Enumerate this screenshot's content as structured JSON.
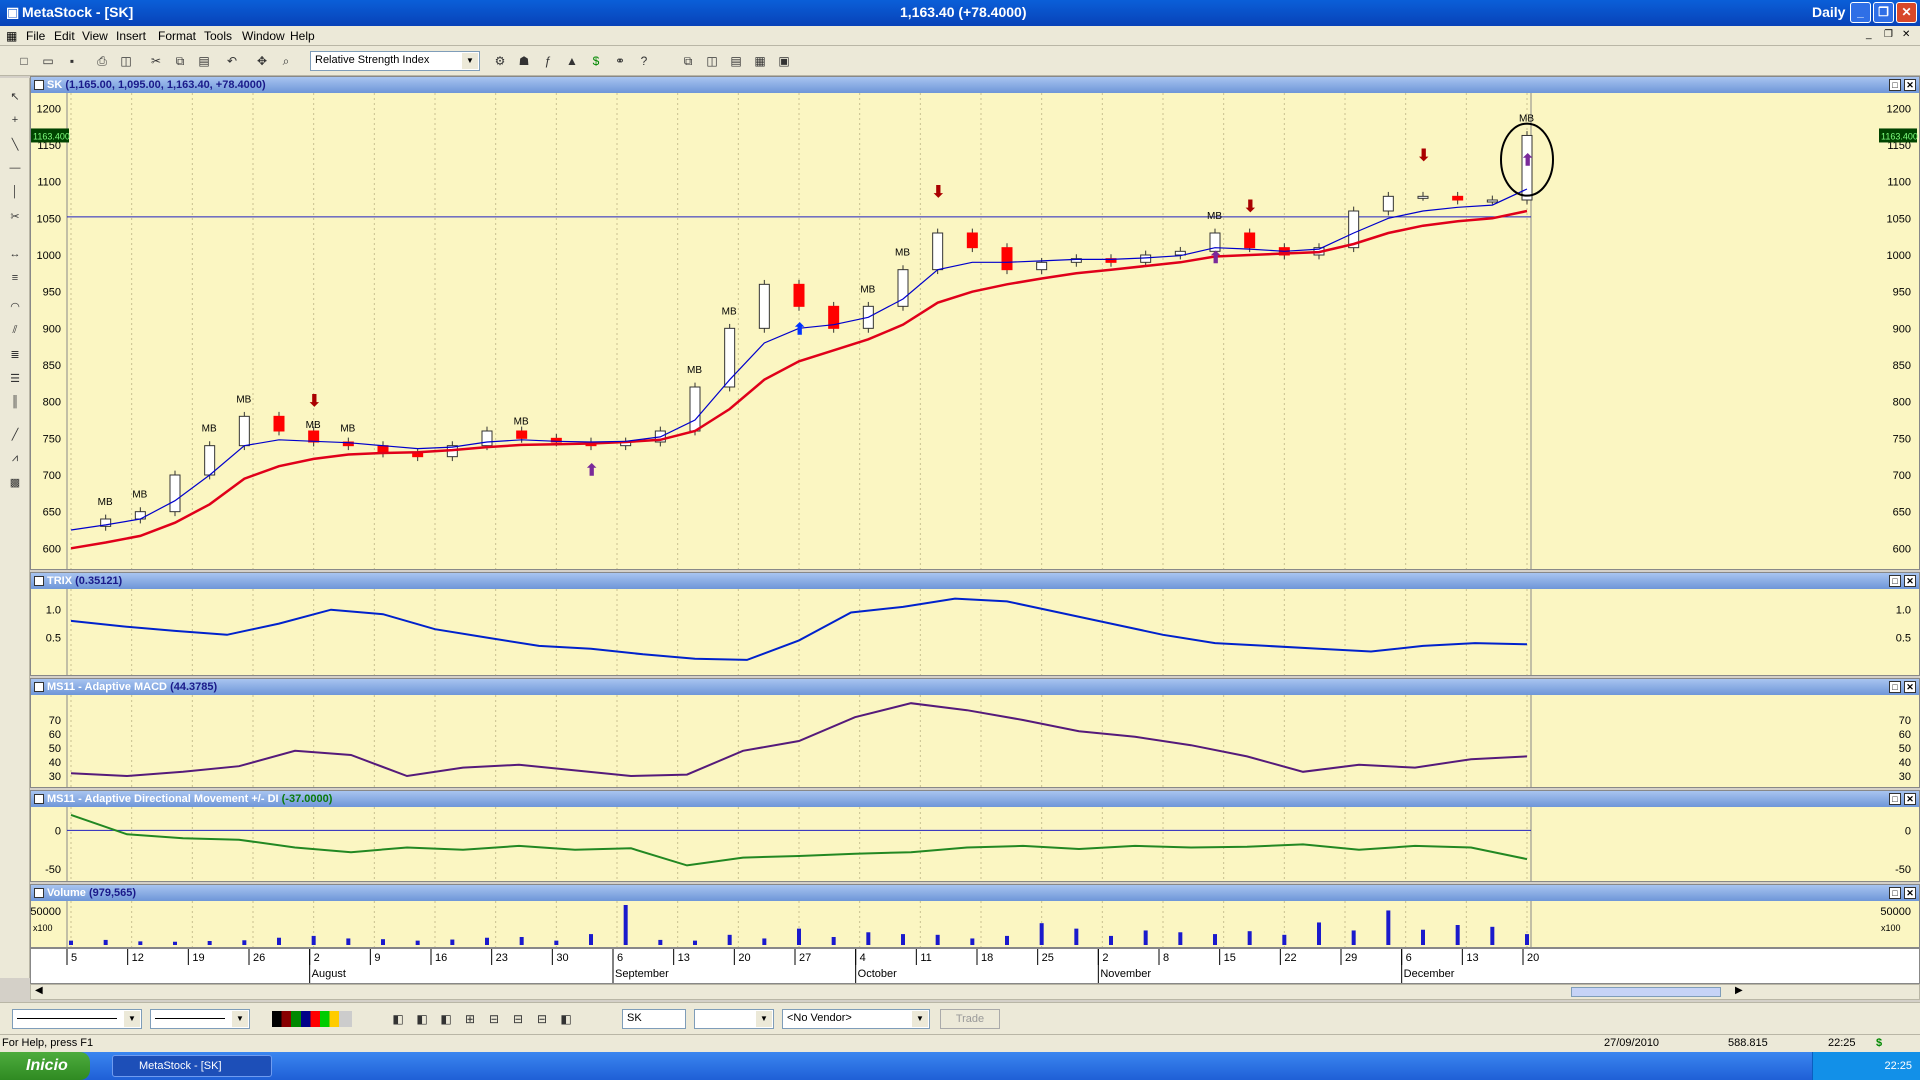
{
  "window": {
    "title": "MetaStock - [SK]",
    "quote": "1,163.40 (+78.4000)",
    "period": "Daily"
  },
  "menu": [
    "File",
    "Edit",
    "View",
    "Insert",
    "Format",
    "Tools",
    "Window",
    "Help"
  ],
  "toolbar": {
    "indicator_select": "Relative Strength Index"
  },
  "panes": {
    "price": {
      "label": "SK",
      "value": "(1,165.00, 1,095.00, 1,163.40, +78.4000)",
      "last_badge": "1163.400",
      "yticks": [
        "1200",
        "1150",
        "1100",
        "1050",
        "1000",
        "950",
        "900",
        "850",
        "800",
        "750",
        "700",
        "650",
        "600"
      ]
    },
    "trix": {
      "label": "TRIX",
      "value": "(0.35121)",
      "yticks": [
        "1.0",
        "0.5"
      ]
    },
    "macd": {
      "label": "MS11 - Adaptive MACD",
      "value": "(44.3785)",
      "yticks": [
        "70",
        "60",
        "50",
        "40",
        "30"
      ]
    },
    "dmi": {
      "label": "MS11 - Adaptive Directional Movement +/- DI",
      "value": "(-37.0000)",
      "yticks": [
        "0",
        "-50"
      ]
    },
    "volume": {
      "label": "Volume",
      "value": "(979,565)",
      "yticks": [
        "50000"
      ],
      "unit": "x100"
    }
  },
  "xaxis": {
    "days": [
      "5",
      "12",
      "19",
      "26",
      "2",
      "9",
      "16",
      "23",
      "30",
      "6",
      "13",
      "20",
      "27",
      "4",
      "11",
      "18",
      "25",
      "2",
      "8",
      "15",
      "22",
      "29",
      "6",
      "13",
      "20"
    ],
    "months": [
      "August",
      "September",
      "October",
      "November",
      "December"
    ]
  },
  "signal_label": "MB",
  "bottom": {
    "symbol": "SK",
    "vendor": "<No Vendor>",
    "trade": "Trade"
  },
  "status": {
    "help": "For Help, press F1",
    "date": "27/09/2010",
    "value": "588.815",
    "time": "22:25",
    "currency": "$"
  },
  "taskbar": {
    "start": "Inicio",
    "task": "MetaStock - [SK]",
    "clock": "22:25"
  },
  "colors": {
    "up": "#ffffff",
    "down": "#ff0000",
    "ma_fast": "#0000cc",
    "ma_slow": "#e0001a",
    "trix": "#0022cc",
    "macd": "#551a7a",
    "dmi": "#228822",
    "volume": "#1a1acc",
    "pane_bg": "#fbf6c2"
  },
  "chart_data": [
    {
      "type": "line",
      "title": "SK",
      "series": [
        {
          "name": "Close",
          "values": [
            630,
            640,
            650,
            700,
            740,
            780,
            760,
            745,
            740,
            730,
            725,
            740,
            760,
            750,
            745,
            740,
            745,
            760,
            820,
            900,
            960,
            930,
            900,
            930,
            980,
            1030,
            1010,
            980,
            990,
            995,
            990,
            1000,
            1005,
            1030,
            1010,
            1000,
            1010,
            1060,
            1080,
            1080,
            1075,
            1075,
            1163
          ]
        },
        {
          "name": "MA Fast",
          "values": [
            625,
            632,
            640,
            665,
            700,
            740,
            748,
            746,
            744,
            740,
            736,
            738,
            745,
            748,
            746,
            745,
            746,
            752,
            775,
            830,
            880,
            900,
            905,
            915,
            940,
            980,
            990,
            990,
            992,
            994,
            994,
            996,
            999,
            1010,
            1008,
            1005,
            1008,
            1030,
            1050,
            1060,
            1065,
            1068,
            1090
          ]
        },
        {
          "name": "MA Slow",
          "values": [
            600,
            608,
            617,
            635,
            660,
            695,
            712,
            722,
            728,
            730,
            731,
            734,
            738,
            741,
            742,
            743,
            745,
            748,
            760,
            790,
            830,
            855,
            870,
            885,
            905,
            935,
            950,
            960,
            968,
            975,
            980,
            985,
            990,
            998,
            1000,
            1002,
            1004,
            1015,
            1030,
            1040,
            1046,
            1050,
            1060
          ]
        }
      ],
      "ylim": [
        580,
        1210
      ]
    },
    {
      "type": "line",
      "title": "TRIX",
      "series": [
        {
          "name": "TRIX",
          "values": [
            0.8,
            0.7,
            0.62,
            0.55,
            0.75,
            1.0,
            0.92,
            0.65,
            0.5,
            0.35,
            0.3,
            0.2,
            0.12,
            0.1,
            0.45,
            0.95,
            1.05,
            1.2,
            1.15,
            0.95,
            0.75,
            0.55,
            0.4,
            0.35,
            0.3,
            0.25,
            0.35,
            0.4,
            0.38
          ]
        }
      ],
      "ylim": [
        -0.1,
        1.3
      ]
    },
    {
      "type": "line",
      "title": "MS11 - Adaptive MACD",
      "series": [
        {
          "name": "MACD",
          "values": [
            32,
            30,
            33,
            37,
            48,
            45,
            30,
            36,
            38,
            34,
            30,
            31,
            48,
            55,
            72,
            82,
            77,
            70,
            62,
            58,
            52,
            44,
            33,
            38,
            36,
            42,
            44
          ]
        }
      ],
      "ylim": [
        25,
        85
      ]
    },
    {
      "type": "line",
      "title": "MS11 - Adaptive Directional Movement +/- DI",
      "series": [
        {
          "name": "DI",
          "values": [
            20,
            -5,
            -10,
            -12,
            -22,
            -28,
            -22,
            -25,
            -20,
            -25,
            -23,
            -45,
            -35,
            -33,
            -30,
            -28,
            -22,
            -20,
            -24,
            -20,
            -22,
            -21,
            -18,
            -25,
            -20,
            -22,
            -37
          ]
        }
      ],
      "ylim": [
        -60,
        25
      ]
    },
    {
      "type": "bar",
      "title": "Volume",
      "values": [
        12,
        14,
        10,
        9,
        11,
        13,
        20,
        25,
        18,
        16,
        12,
        15,
        20,
        22,
        12,
        30,
        110,
        14,
        12,
        28,
        18,
        45,
        22,
        35,
        30,
        28,
        18,
        25,
        60,
        45,
        25,
        40,
        35,
        30,
        38,
        28,
        62,
        40,
        95,
        42,
        55,
        50,
        30
      ]
    }
  ]
}
